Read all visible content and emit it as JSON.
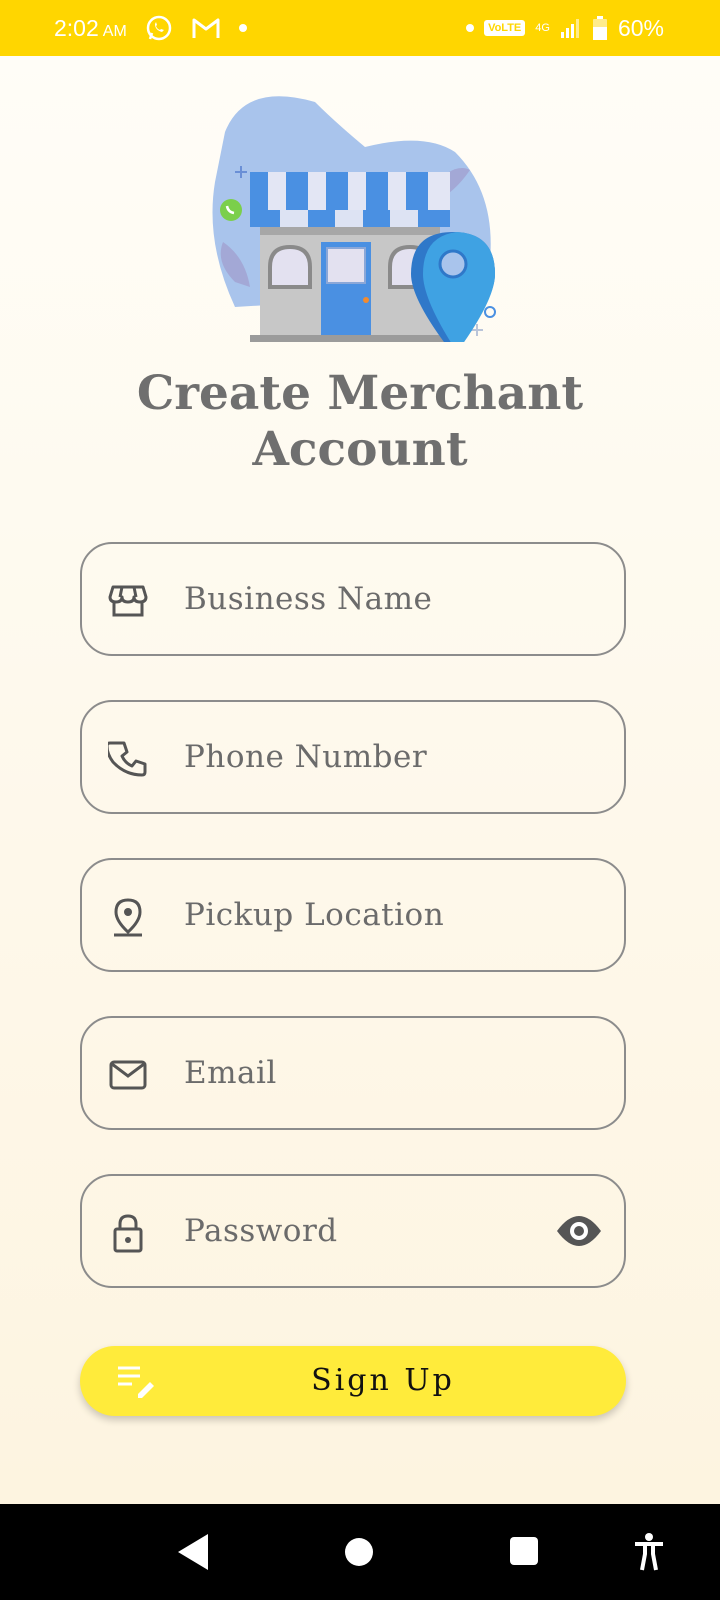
{
  "status_bar": {
    "time": "2:02",
    "ampm": "AM",
    "network": "VoLTE",
    "signal_type": "4G",
    "battery": "60%",
    "icons": [
      "whatsapp-icon",
      "gmail-icon",
      "notification-dot-icon",
      "signal-icon",
      "battery-icon"
    ]
  },
  "hero": {
    "illustration": "store-with-location-pin-illustration"
  },
  "page": {
    "title": "Create Merchant Account"
  },
  "form": {
    "business_name": {
      "placeholder": "Business Name",
      "icon": "store-icon"
    },
    "phone_number": {
      "placeholder": "Phone Number",
      "icon": "phone-icon"
    },
    "pickup_location": {
      "placeholder": "Pickup Location",
      "icon": "location-pin-icon"
    },
    "email": {
      "placeholder": "Email",
      "icon": "mail-icon"
    },
    "password": {
      "placeholder": "Password",
      "icon": "lock-icon",
      "toggle_icon": "eye-icon"
    }
  },
  "signup_button": {
    "label": "Sign Up",
    "icon": "edit-list-icon"
  },
  "nav_bar": {
    "buttons": [
      "back-icon",
      "home-icon",
      "recents-icon",
      "accessibility-icon"
    ]
  },
  "colors": {
    "status_bar": "#ffd600",
    "button": "#ffeb3b",
    "background": "#fdf8ec",
    "field_border": "#8c8c8c",
    "text": "#6b6b6b",
    "store_blue": "#4a90e2",
    "pin_blue": "#3b9be0"
  }
}
